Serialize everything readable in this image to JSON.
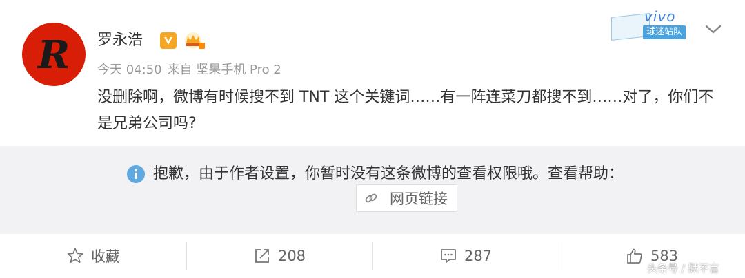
{
  "post": {
    "author": {
      "name": "罗永浩",
      "avatar_letter": "R",
      "verified_badge": "V"
    },
    "meta": {
      "time": "今天 04:50",
      "source": "来自 坚果手机 Pro 2"
    },
    "team_badge": {
      "brand": "vivo",
      "tag": "球迷站队"
    },
    "text": "没删除啊，微博有时候搜不到 TNT 这个关键词……有一阵连菜刀都搜不到……对了，你们不是兄弟公司吗?"
  },
  "notice": {
    "message": "抱歉，由于作者设置，你暂时没有这条微博的查看权限哦。查看帮助：",
    "link_label": "网页链接"
  },
  "actions": {
    "favorite_label": "收藏",
    "repost_count": "208",
    "comment_count": "287",
    "like_count": "583"
  },
  "watermark": "头条号 / 默不言",
  "colors": {
    "avatar_bg": "#d81e06",
    "verified": "#f5a623",
    "info_icon": "#5fa9e0",
    "notice_bg": "#f2f2f5",
    "brand_blue": "#4183d7"
  },
  "icons": [
    "info-icon",
    "link-icon",
    "star-icon",
    "share-icon",
    "comment-icon",
    "thumbs-up-icon",
    "chevron-down-icon",
    "crown-icon"
  ]
}
